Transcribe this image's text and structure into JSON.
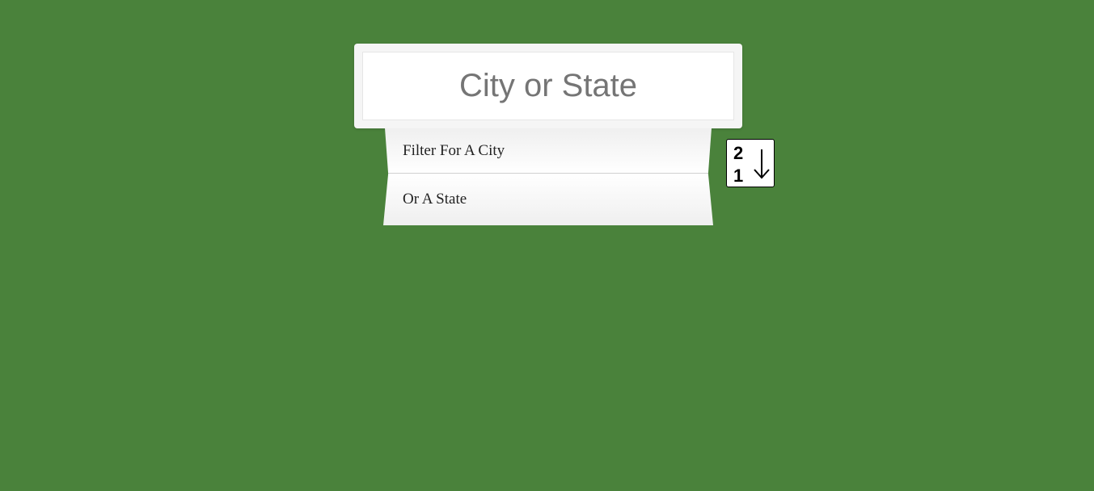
{
  "search": {
    "placeholder": "City or State",
    "value": ""
  },
  "suggestions": [
    {
      "label": "Filter For A City"
    },
    {
      "label": "Or A State"
    }
  ],
  "sort_button": {
    "top_digit": "2",
    "bottom_digit": "1",
    "icon": "sort-descending-arrow-icon"
  },
  "colors": {
    "background": "#4a823b",
    "panel": "#f5f5f5",
    "text": "#222222"
  }
}
